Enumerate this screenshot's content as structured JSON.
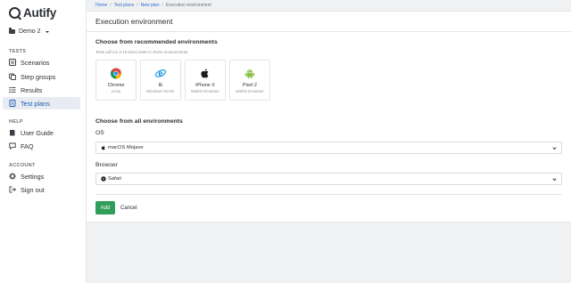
{
  "app": {
    "brand": "Autify"
  },
  "sidebar": {
    "workspace": "Demo 2",
    "sections": {
      "tests": "TESTS",
      "help": "HELP",
      "account": "ACCOUNT"
    },
    "items": [
      {
        "label": "Scenarios",
        "icon": "scenarios-icon"
      },
      {
        "label": "Step groups",
        "icon": "step-groups-icon"
      },
      {
        "label": "Results",
        "icon": "results-icon"
      },
      {
        "label": "Test plans",
        "icon": "test-plans-icon",
        "active": true
      },
      {
        "label": "User Guide",
        "icon": "book-icon"
      },
      {
        "label": "FAQ",
        "icon": "faq-icon"
      },
      {
        "label": "Settings",
        "icon": "gear-icon"
      },
      {
        "label": "Sign out",
        "icon": "sign-out-icon"
      }
    ]
  },
  "breadcrumb": {
    "items": [
      "Home",
      "Test plans",
      "New plan"
    ],
    "current": "Execution environment",
    "separator": "/"
  },
  "page": {
    "title": "Execution environment"
  },
  "recommended": {
    "heading": "Choose from recommended environments",
    "subtext": "Tests will run 3-10 times faster in these environments.",
    "environments": [
      {
        "name": "Chrome",
        "desc": "Linux",
        "icon": "chrome-icon"
      },
      {
        "name": "IE",
        "desc": "Windows Server",
        "icon": "ie-icon"
      },
      {
        "name": "iPhone X",
        "desc": "Mobile Emulator",
        "icon": "apple-icon"
      },
      {
        "name": "Pixel 2",
        "desc": "Mobile Emulator",
        "icon": "android-icon"
      }
    ]
  },
  "all_envs": {
    "heading": "Choose from all environments",
    "os_label": "OS",
    "os_value": "macOS Mojave",
    "browser_label": "Browser",
    "browser_value": "Safari"
  },
  "actions": {
    "add": "Add",
    "cancel": "Cancel"
  },
  "colors": {
    "accent_blue": "#1c5ab5",
    "link_blue": "#2f6fd0",
    "add_green": "#2f9e5a",
    "background": "#f0f1f3"
  }
}
